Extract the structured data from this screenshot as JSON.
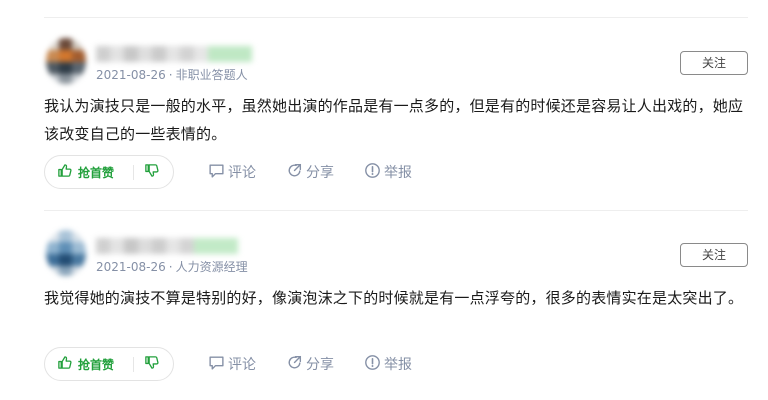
{
  "answers": [
    {
      "meta_date": "2021-08-26",
      "meta_separator": "·",
      "meta_role": "非职业答题人",
      "follow_label": "关注",
      "content": "我认为演技只是一般的水平，虽然她出演的作品是有一点多的，但是有的时候还是容易让人出戏的，她应该改变自己的一些表情的。",
      "vote_label": "抢首赞",
      "comment_label": "评论",
      "share_label": "分享",
      "report_label": "举报"
    },
    {
      "meta_date": "2021-08-26",
      "meta_separator": "·",
      "meta_role": "人力资源经理",
      "follow_label": "关注",
      "content": "我觉得她的演技不算是特别的好，像演泡沫之下的时候就是有一点浮夸的，很多的表情实在是太突出了。",
      "vote_label": "抢首赞",
      "comment_label": "评论",
      "share_label": "分享",
      "report_label": "举报"
    }
  ],
  "icons": {
    "vote_up": "thumbs-up-icon",
    "vote_down": "thumbs-down-icon",
    "comment": "comment-icon",
    "share": "share-icon",
    "report": "report-icon"
  },
  "colors": {
    "vote_green": "#22a03c",
    "meta_grey": "#8590a6",
    "action_grey": "#8590a6"
  }
}
